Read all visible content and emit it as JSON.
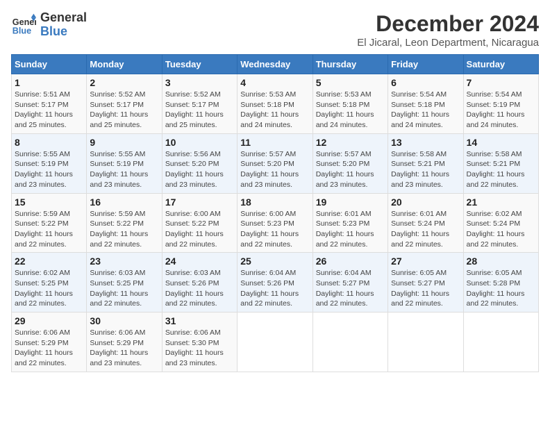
{
  "header": {
    "logo_general": "General",
    "logo_blue": "Blue",
    "month_title": "December 2024",
    "location": "El Jicaral, Leon Department, Nicaragua"
  },
  "days_of_week": [
    "Sunday",
    "Monday",
    "Tuesday",
    "Wednesday",
    "Thursday",
    "Friday",
    "Saturday"
  ],
  "weeks": [
    [
      {
        "day": "1",
        "info": "Sunrise: 5:51 AM\nSunset: 5:17 PM\nDaylight: 11 hours\nand 25 minutes."
      },
      {
        "day": "2",
        "info": "Sunrise: 5:52 AM\nSunset: 5:17 PM\nDaylight: 11 hours\nand 25 minutes."
      },
      {
        "day": "3",
        "info": "Sunrise: 5:52 AM\nSunset: 5:17 PM\nDaylight: 11 hours\nand 25 minutes."
      },
      {
        "day": "4",
        "info": "Sunrise: 5:53 AM\nSunset: 5:18 PM\nDaylight: 11 hours\nand 24 minutes."
      },
      {
        "day": "5",
        "info": "Sunrise: 5:53 AM\nSunset: 5:18 PM\nDaylight: 11 hours\nand 24 minutes."
      },
      {
        "day": "6",
        "info": "Sunrise: 5:54 AM\nSunset: 5:18 PM\nDaylight: 11 hours\nand 24 minutes."
      },
      {
        "day": "7",
        "info": "Sunrise: 5:54 AM\nSunset: 5:19 PM\nDaylight: 11 hours\nand 24 minutes."
      }
    ],
    [
      {
        "day": "8",
        "info": "Sunrise: 5:55 AM\nSunset: 5:19 PM\nDaylight: 11 hours\nand 23 minutes."
      },
      {
        "day": "9",
        "info": "Sunrise: 5:55 AM\nSunset: 5:19 PM\nDaylight: 11 hours\nand 23 minutes."
      },
      {
        "day": "10",
        "info": "Sunrise: 5:56 AM\nSunset: 5:20 PM\nDaylight: 11 hours\nand 23 minutes."
      },
      {
        "day": "11",
        "info": "Sunrise: 5:57 AM\nSunset: 5:20 PM\nDaylight: 11 hours\nand 23 minutes."
      },
      {
        "day": "12",
        "info": "Sunrise: 5:57 AM\nSunset: 5:20 PM\nDaylight: 11 hours\nand 23 minutes."
      },
      {
        "day": "13",
        "info": "Sunrise: 5:58 AM\nSunset: 5:21 PM\nDaylight: 11 hours\nand 23 minutes."
      },
      {
        "day": "14",
        "info": "Sunrise: 5:58 AM\nSunset: 5:21 PM\nDaylight: 11 hours\nand 22 minutes."
      }
    ],
    [
      {
        "day": "15",
        "info": "Sunrise: 5:59 AM\nSunset: 5:22 PM\nDaylight: 11 hours\nand 22 minutes."
      },
      {
        "day": "16",
        "info": "Sunrise: 5:59 AM\nSunset: 5:22 PM\nDaylight: 11 hours\nand 22 minutes."
      },
      {
        "day": "17",
        "info": "Sunrise: 6:00 AM\nSunset: 5:22 PM\nDaylight: 11 hours\nand 22 minutes."
      },
      {
        "day": "18",
        "info": "Sunrise: 6:00 AM\nSunset: 5:23 PM\nDaylight: 11 hours\nand 22 minutes."
      },
      {
        "day": "19",
        "info": "Sunrise: 6:01 AM\nSunset: 5:23 PM\nDaylight: 11 hours\nand 22 minutes."
      },
      {
        "day": "20",
        "info": "Sunrise: 6:01 AM\nSunset: 5:24 PM\nDaylight: 11 hours\nand 22 minutes."
      },
      {
        "day": "21",
        "info": "Sunrise: 6:02 AM\nSunset: 5:24 PM\nDaylight: 11 hours\nand 22 minutes."
      }
    ],
    [
      {
        "day": "22",
        "info": "Sunrise: 6:02 AM\nSunset: 5:25 PM\nDaylight: 11 hours\nand 22 minutes."
      },
      {
        "day": "23",
        "info": "Sunrise: 6:03 AM\nSunset: 5:25 PM\nDaylight: 11 hours\nand 22 minutes."
      },
      {
        "day": "24",
        "info": "Sunrise: 6:03 AM\nSunset: 5:26 PM\nDaylight: 11 hours\nand 22 minutes."
      },
      {
        "day": "25",
        "info": "Sunrise: 6:04 AM\nSunset: 5:26 PM\nDaylight: 11 hours\nand 22 minutes."
      },
      {
        "day": "26",
        "info": "Sunrise: 6:04 AM\nSunset: 5:27 PM\nDaylight: 11 hours\nand 22 minutes."
      },
      {
        "day": "27",
        "info": "Sunrise: 6:05 AM\nSunset: 5:27 PM\nDaylight: 11 hours\nand 22 minutes."
      },
      {
        "day": "28",
        "info": "Sunrise: 6:05 AM\nSunset: 5:28 PM\nDaylight: 11 hours\nand 22 minutes."
      }
    ],
    [
      {
        "day": "29",
        "info": "Sunrise: 6:06 AM\nSunset: 5:29 PM\nDaylight: 11 hours\nand 22 minutes."
      },
      {
        "day": "30",
        "info": "Sunrise: 6:06 AM\nSunset: 5:29 PM\nDaylight: 11 hours\nand 23 minutes."
      },
      {
        "day": "31",
        "info": "Sunrise: 6:06 AM\nSunset: 5:30 PM\nDaylight: 11 hours\nand 23 minutes."
      },
      null,
      null,
      null,
      null
    ]
  ]
}
